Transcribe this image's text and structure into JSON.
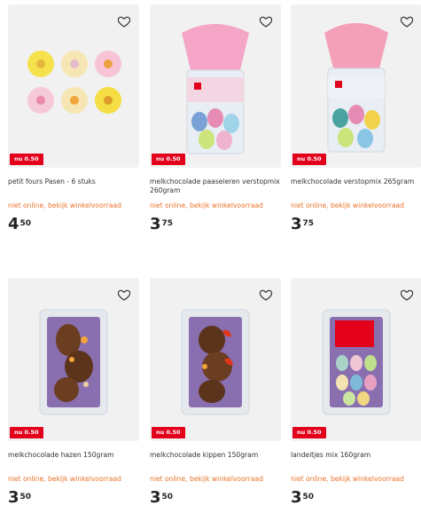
{
  "products": [
    {
      "badge": "nu 0.50",
      "title": "petit fours Pasen - 6 stuks",
      "availability": "niet online, bekijk winkelvoorraad",
      "price_int": "4",
      "price_dec": "50"
    },
    {
      "badge": "nu 0.50",
      "title": "melkchocolade paaseieren verstopmix 260gram",
      "availability": "niet online, bekijk winkelvoorraad",
      "price_int": "3",
      "price_dec": "75"
    },
    {
      "badge": "nu 0.50",
      "title": "melkchocolade verstopmix 265gram",
      "availability": "niet online, bekijk winkelvoorraad",
      "price_int": "3",
      "price_dec": "75"
    },
    {
      "badge": "nu 0.50",
      "title": "melkchocolade hazen 150gram",
      "availability": "niet online, bekijk winkelvoorraad",
      "price_int": "3",
      "price_dec": "50"
    },
    {
      "badge": "nu 0.50",
      "title": "melkchocolade kippen 150gram",
      "availability": "niet online, bekijk winkelvoorraad",
      "price_int": "3",
      "price_dec": "50"
    },
    {
      "badge": "nu 0.50",
      "title": "landeitjes mix 160gram",
      "availability": "niet online, bekijk winkelvoorraad",
      "price_int": "3",
      "price_dec": "50"
    }
  ],
  "colors": {
    "badge": "#e3001b",
    "availability": "#e8732a",
    "card_bg": "#f1f1f1"
  },
  "icons": {
    "favorite": "heart-outline-icon"
  }
}
